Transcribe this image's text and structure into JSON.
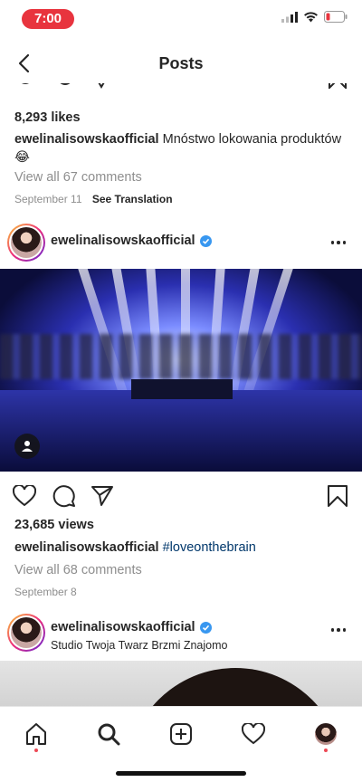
{
  "status_bar": {
    "time": "7:00"
  },
  "nav": {
    "title": "Posts"
  },
  "previous_post": {
    "likes": "8,293 likes",
    "username": "ewelinalisowskaofficial",
    "caption": "Mnóstwo lokowania produktów 😂",
    "view_comments": "View all 67 comments",
    "date": "September 11",
    "see_translation": "See Translation"
  },
  "post": {
    "username": "ewelinalisowskaofficial",
    "views": "23,685 views",
    "caption_username": "ewelinalisowskaofficial",
    "hashtag": "#loveonthebrain",
    "view_comments": "View all 68 comments",
    "date": "September 8"
  },
  "next_post": {
    "username": "ewelinalisowskaofficial",
    "location": "Studio Twoja Twarz Brzmi Znajomo"
  },
  "colors": {
    "time_pill": "#e8343e",
    "verified": "#3897f0",
    "hashtag": "#00376b",
    "notification_dot": "#ed4956"
  },
  "tab_bar": {
    "icons": [
      "home-icon",
      "search-icon",
      "new-post-icon",
      "activity-heart-icon",
      "profile-avatar"
    ]
  }
}
